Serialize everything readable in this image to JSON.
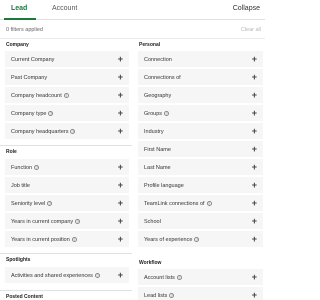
{
  "tabs": {
    "lead": "Lead",
    "account": "Account",
    "collapse": "Collapse"
  },
  "filters": {
    "count_text": "0 filters applied",
    "clear_all": "Clear all"
  },
  "left_column": {
    "company": {
      "title": "Company",
      "items": [
        {
          "label": "Current Company",
          "info": false
        },
        {
          "label": "Past Company",
          "info": false
        },
        {
          "label": "Company headcount",
          "info": true
        },
        {
          "label": "Company type",
          "info": true
        },
        {
          "label": "Company headquarters",
          "info": true
        }
      ]
    },
    "role": {
      "title": "Role",
      "items": [
        {
          "label": "Function",
          "info": true
        },
        {
          "label": "Job title",
          "info": false
        },
        {
          "label": "Seniority level",
          "info": true
        },
        {
          "label": "Years in current company",
          "info": true
        },
        {
          "label": "Years in current position",
          "info": true
        }
      ]
    },
    "spotlights": {
      "title": "Spotlights",
      "items": [
        {
          "label": "Activities and shared experiences",
          "info": true
        }
      ]
    },
    "posted_content": {
      "title": "Posted Content"
    }
  },
  "right_column": {
    "personal": {
      "title": "Personal",
      "items": [
        {
          "label": "Connection",
          "info": false
        },
        {
          "label": "Connections of",
          "info": false
        },
        {
          "label": "Geography",
          "info": false
        },
        {
          "label": "Groups",
          "info": true
        },
        {
          "label": "Industry",
          "info": false
        },
        {
          "label": "First Name",
          "info": false
        },
        {
          "label": "Last Name",
          "info": false
        },
        {
          "label": "Profile language",
          "info": false
        },
        {
          "label": "TeamLink connections of",
          "info": true
        },
        {
          "label": "School",
          "info": false
        },
        {
          "label": "Years of experience",
          "info": true
        }
      ]
    },
    "workflow": {
      "title": "Workflow",
      "items": [
        {
          "label": "Account lists",
          "info": true
        },
        {
          "label": "Lead lists",
          "info": true
        }
      ]
    }
  },
  "icons": {
    "add": "plus-icon",
    "info": "info-icon"
  },
  "colors": {
    "accent": "#1a7a3c",
    "row_bg": "#f6f6f6"
  }
}
